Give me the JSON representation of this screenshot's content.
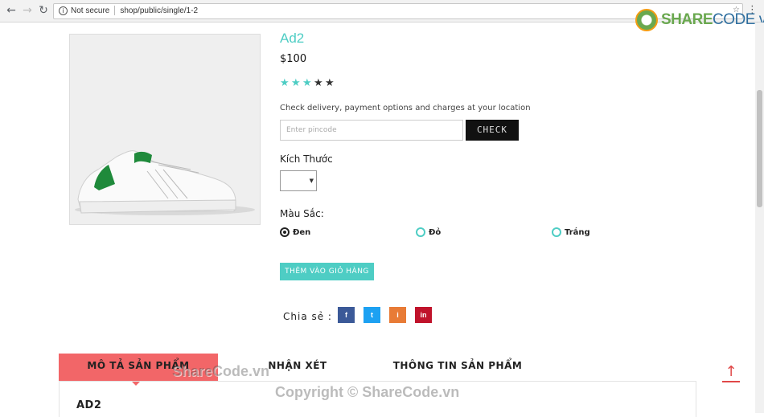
{
  "browser": {
    "security_label": "Not secure",
    "url_path": "shop/public/single/1-2"
  },
  "logo": {
    "brand_a": "SHARE",
    "brand_b": "CODE.vn"
  },
  "product": {
    "title": "Ad2",
    "price": "$100",
    "rating": {
      "value": 3,
      "max": 5
    },
    "delivery_text": "Check delivery, payment options and charges at your location",
    "pincode_placeholder": "Enter pincode",
    "check_label": "CHECK",
    "size_label": "Kích Thước",
    "size_selected": "",
    "color_label": "Màu Sắc:",
    "colors": [
      {
        "label": "Đen",
        "checked": true
      },
      {
        "label": "Đỏ",
        "checked": false
      },
      {
        "label": "Trắng",
        "checked": false
      }
    ],
    "add_to_cart_label": "THÊM VÀO GIỎ HÀNG",
    "share_label": "Chia sẻ :",
    "social": [
      "f",
      "t",
      "i",
      "in"
    ]
  },
  "tabs": [
    {
      "label": "MÔ TẢ SẢN PHẨM",
      "active": true
    },
    {
      "label": "NHẬN XÉT",
      "active": false
    },
    {
      "label": "THÔNG TIN SẢN PHẨM",
      "active": false
    }
  ],
  "panel": {
    "title": "AD2"
  },
  "watermarks": {
    "mid": "ShareCode.vn",
    "bottom": "Copyright © ShareCode.vn"
  },
  "colors": {
    "accent": "#4ecdc4",
    "tab_active": "#f26668",
    "star_empty": "#333333"
  }
}
